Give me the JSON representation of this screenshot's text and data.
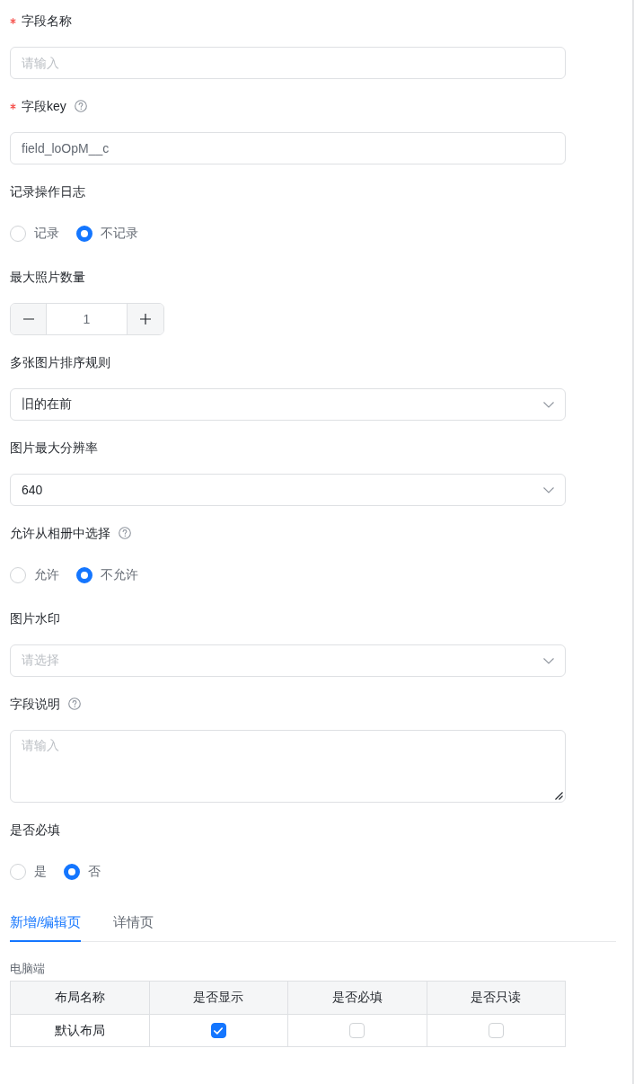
{
  "fields": [
    {
      "kind": "input",
      "label": "字段名称",
      "required": true,
      "help": false,
      "placeholder": "请输入"
    },
    {
      "kind": "input",
      "label": "字段key",
      "required": true,
      "help": true,
      "value": "field_loOpM__c"
    },
    {
      "kind": "radio",
      "label": "记录操作日志",
      "required": false,
      "help": false,
      "options": [
        {
          "label": "记录",
          "selected": false
        },
        {
          "label": "不记录",
          "selected": true
        }
      ]
    },
    {
      "kind": "stepper",
      "label": "最大照片数量",
      "required": false,
      "help": false,
      "value": "1"
    },
    {
      "kind": "select",
      "label": "多张图片排序规则",
      "required": false,
      "help": false,
      "value": "旧的在前"
    },
    {
      "kind": "select",
      "label": "图片最大分辨率",
      "required": false,
      "help": false,
      "value": "640"
    },
    {
      "kind": "radio",
      "label": "允许从相册中选择",
      "required": false,
      "help": true,
      "options": [
        {
          "label": "允许",
          "selected": false
        },
        {
          "label": "不允许",
          "selected": true
        }
      ]
    },
    {
      "kind": "select",
      "label": "图片水印",
      "required": false,
      "help": false,
      "placeholder": "请选择"
    },
    {
      "kind": "textarea",
      "label": "字段说明",
      "required": false,
      "help": true,
      "placeholder": "请输入"
    },
    {
      "kind": "radio",
      "label": "是否必填",
      "required": false,
      "help": false,
      "options": [
        {
          "label": "是",
          "selected": false
        },
        {
          "label": "否",
          "selected": true
        }
      ]
    }
  ],
  "tabs": [
    {
      "label": "新增/编辑页",
      "selected": true
    },
    {
      "label": "详情页",
      "selected": false
    }
  ],
  "layout_table": {
    "caption": "电脑端",
    "columns": [
      "布局名称",
      "是否显示",
      "是否必填",
      "是否只读"
    ],
    "rows": [
      {
        "name": "默认布局",
        "cells": [
          {
            "checked": true
          },
          {
            "checked": false
          },
          {
            "checked": false
          }
        ]
      }
    ]
  }
}
